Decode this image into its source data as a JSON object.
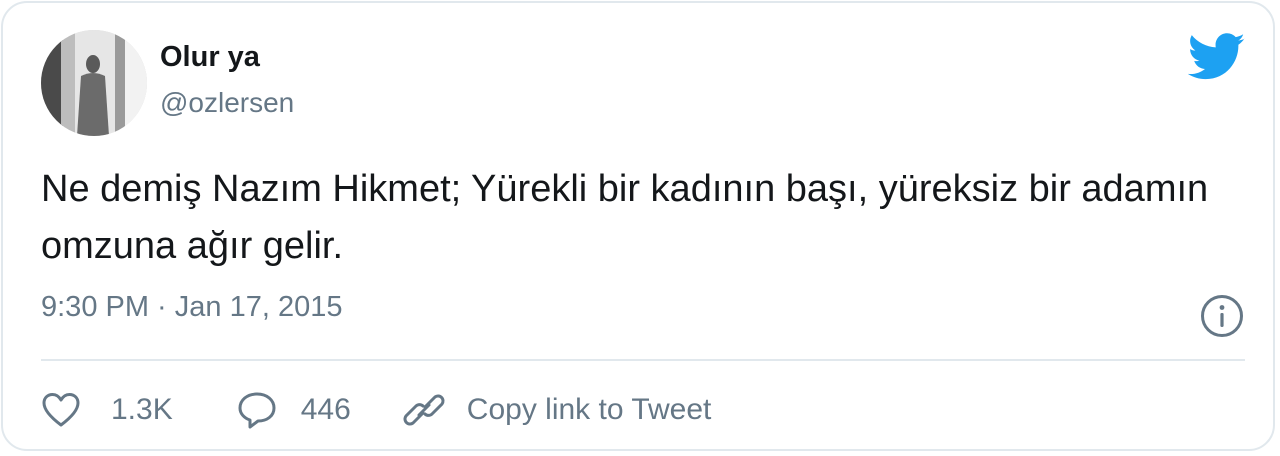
{
  "tweet": {
    "author": {
      "display_name": "Olur ya",
      "handle": "@ozlersen",
      "avatar_icon": "avatar"
    },
    "text": "Ne demiş Nazım Hikmet; Yürekli bir kadının başı, yüreksiz bir adamın omzuna ağır gelir.",
    "timestamp": "9:30 PM · Jan 17, 2015",
    "brand_icon": "twitter-bird-icon",
    "info_icon": "info-icon"
  },
  "actions": {
    "like": {
      "icon": "heart-icon",
      "count": "1.3K"
    },
    "reply": {
      "icon": "speech-bubble-icon",
      "count": "446"
    },
    "copy_link": {
      "icon": "link-icon",
      "label": "Copy link to Tweet"
    }
  },
  "colors": {
    "text_primary": "#14171a",
    "text_secondary": "#657786",
    "twitter_blue": "#1da1f2",
    "border": "#e1e8ed"
  }
}
